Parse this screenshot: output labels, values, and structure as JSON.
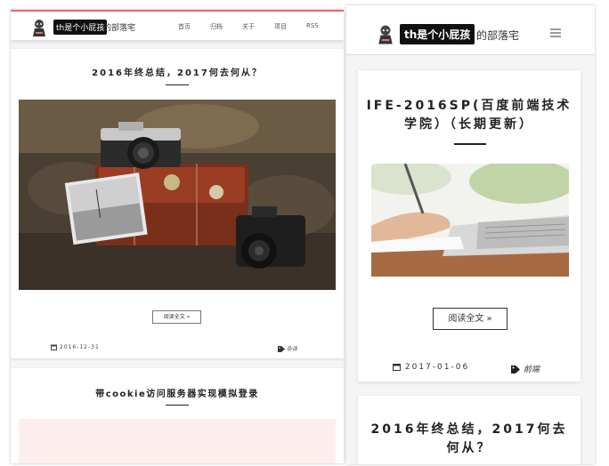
{
  "site": {
    "brand": "th是个小屁孩",
    "brand_suffix": "的部落宅"
  },
  "nav": {
    "items": [
      "首页",
      "归档",
      "关于",
      "项目",
      "RSS"
    ]
  },
  "desktop": {
    "post1": {
      "title": "2016年终总结，2017何去何从？",
      "read_more": "阅读全文 »",
      "date": "2016-12-31",
      "tag": "杂谈"
    },
    "post2": {
      "title": "带cookie访问服务器实现模拟登录"
    }
  },
  "mobile": {
    "post1": {
      "title": "IFE-2016SP(百度前端技术学院）（长期更新）",
      "read_more": "阅读全文 »",
      "date": "2017-01-06",
      "tag": "前端"
    },
    "post2": {
      "title": "2016年终总结，2017何去何从？"
    }
  },
  "icons": {
    "calendar": "calendar-icon",
    "tag": "tag-icon",
    "menu": "hamburger-menu-icon"
  },
  "colors": {
    "header_accent": "#e8666d",
    "brand_bg": "#111111"
  }
}
